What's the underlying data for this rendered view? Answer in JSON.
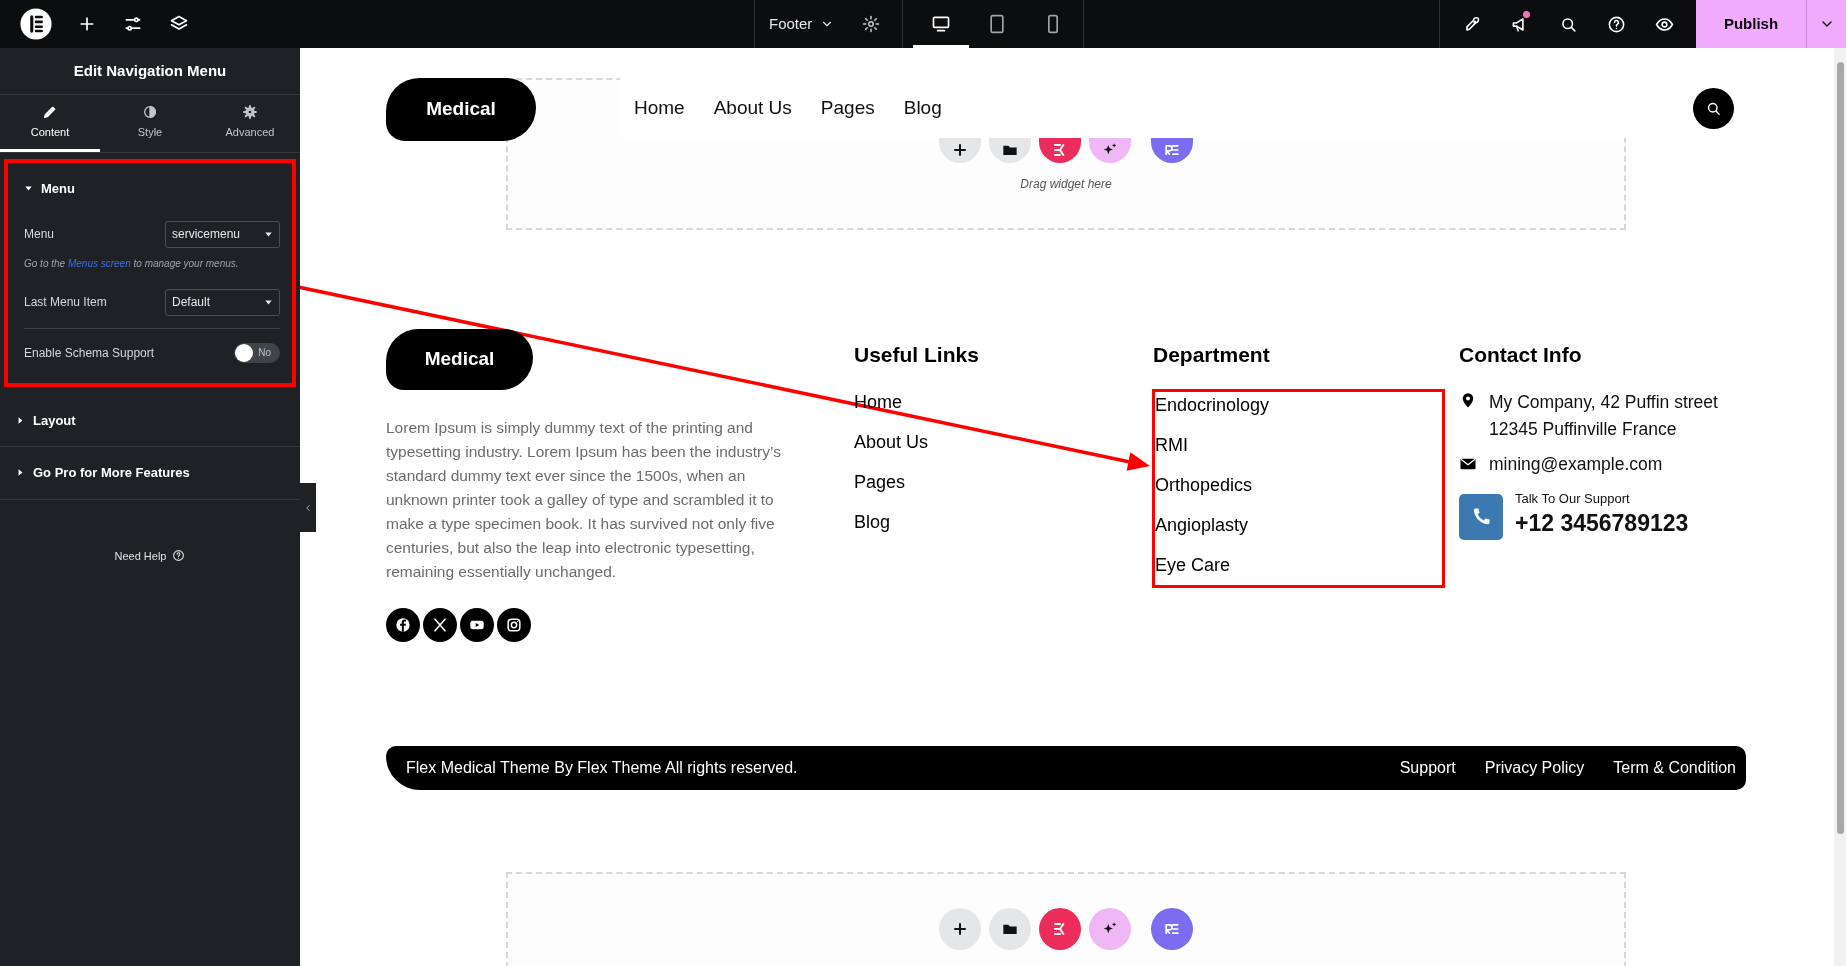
{
  "topbar": {
    "document": "Footer",
    "publish": "Publish",
    "notification": true,
    "devices": [
      {
        "kind": "desktop",
        "selected": true
      },
      {
        "kind": "tablet",
        "selected": false
      },
      {
        "kind": "mobile",
        "selected": false
      }
    ]
  },
  "panel": {
    "title": "Edit Navigation Menu",
    "tabs": [
      {
        "label": "Content",
        "kind": "pencil",
        "selected": true
      },
      {
        "label": "Style",
        "kind": "contrast",
        "selected": false
      },
      {
        "label": "Advanced",
        "kind": "gear",
        "selected": false
      }
    ],
    "sections": [
      {
        "title": "Menu",
        "expanded": true,
        "highlighted": true,
        "controls": [
          {
            "kind": "select",
            "label": "Menu",
            "value": "servicemenu"
          },
          {
            "kind": "note",
            "before": "Go to the",
            "link": "Menus screen",
            "after": "to manage your menus."
          },
          {
            "kind": "select",
            "label": "Last Menu Item",
            "value": "Default"
          },
          {
            "kind": "switch",
            "label": "Enable Schema Support",
            "on": false,
            "state_text": "No"
          }
        ]
      },
      {
        "title": "Layout",
        "expanded": false,
        "highlighted": false
      },
      {
        "title": "Go Pro for More Features",
        "expanded": false,
        "highlighted": false
      }
    ],
    "help": "Need Help"
  },
  "header": {
    "logo": "Medical",
    "nav": [
      "Home",
      "About Us",
      "Pages",
      "Blog"
    ]
  },
  "top_drop_zone": {
    "hint": "Drag widget here"
  },
  "footer": {
    "logo": "Medical",
    "about": "Lorem Ipsum is simply dummy text of the printing and typesetting industry. Lorem Ipsum has been the industry’s standard dummy text ever since the 1500s, when an unknown printer took a galley of type and scrambled it to make a type specimen book. It has survived not only five centuries, but also the leap into electronic typesetting, remaining essentially unchanged.",
    "socials": [
      {
        "kind": "facebook"
      },
      {
        "kind": "x"
      },
      {
        "kind": "youtube"
      },
      {
        "kind": "instagram"
      }
    ],
    "useful_links": {
      "title": "Useful Links",
      "links": [
        "Home",
        "About Us",
        "Pages",
        "Blog"
      ]
    },
    "department": {
      "title": "Department",
      "highlighted": true,
      "links": [
        "Endocrinology",
        "RMI",
        "Orthopedics",
        "Angioplasty",
        "Eye Care"
      ]
    },
    "contact": {
      "title": "Contact Info",
      "address": "My Company, 42 Puffin street 12345 Puffinville France",
      "email": "mining@example.com",
      "support_label": "Talk To Our Support",
      "phone": "+12 3456789123"
    }
  },
  "bottom_bar": {
    "copyright": "Flex Medical Theme By Flex Theme All rights reserved.",
    "links": [
      "Support",
      "Privacy Policy",
      "Term & Condition"
    ]
  }
}
